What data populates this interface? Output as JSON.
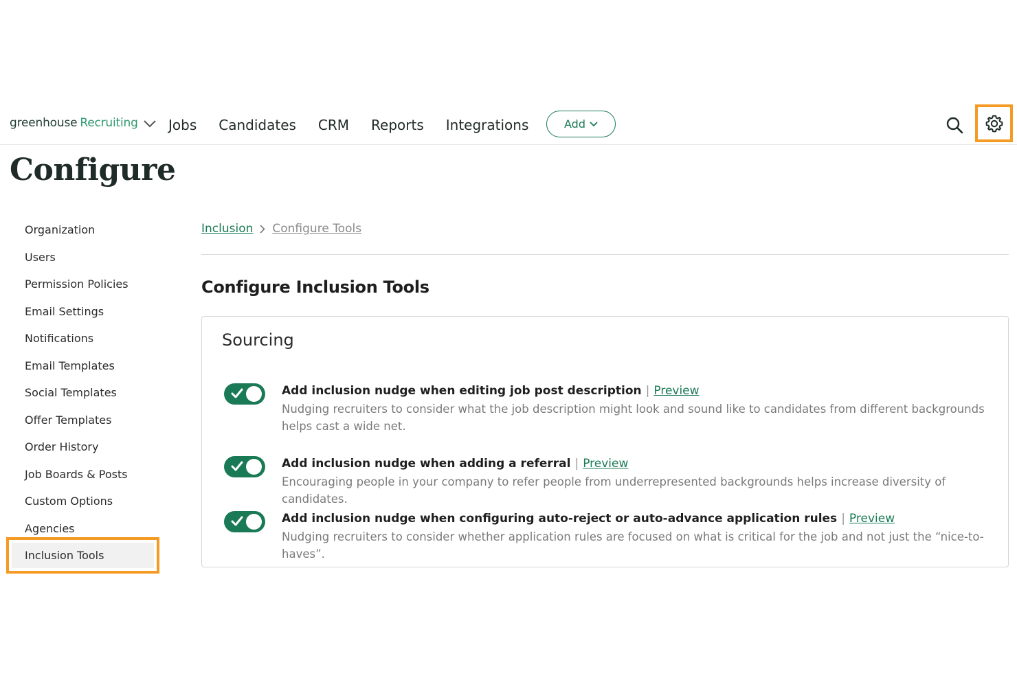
{
  "nav": {
    "logo_brand": "greenhouse",
    "logo_product": "Recruiting",
    "links": [
      "Jobs",
      "Candidates",
      "CRM",
      "Reports",
      "Integrations"
    ],
    "add_label": "Add",
    "search_icon": "search-icon",
    "settings_icon": "gear-icon"
  },
  "page": {
    "title": "Configure"
  },
  "sidebar": {
    "items": [
      "Organization",
      "Users",
      "Permission Policies",
      "Email Settings",
      "Notifications",
      "Email Templates",
      "Social Templates",
      "Offer Templates",
      "Order History",
      "Job Boards & Posts",
      "Custom Options",
      "Agencies",
      "Inclusion Tools"
    ],
    "active": "Inclusion Tools"
  },
  "breadcrumb": {
    "parent": "Inclusion",
    "current": "Configure Tools"
  },
  "main": {
    "heading": "Configure Inclusion Tools",
    "card_title": "Sourcing",
    "settings": [
      {
        "title": "Add inclusion nudge when editing job post description",
        "link": "Preview",
        "description": "Nudging recruiters to consider what the job description might look and sound like to candidates from different backgrounds helps cast a wide net.",
        "enabled": true
      },
      {
        "title": "Add inclusion nudge when adding a referral",
        "link": "Preview",
        "description": "Encouraging people in your company to refer people from underrepresented backgrounds helps increase diversity of candidates.",
        "enabled": true
      },
      {
        "title": "Add inclusion nudge when configuring auto-reject or auto-advance application rules",
        "link": "Preview",
        "description": "Nudging recruiters to consider whether application rules are focused on what is critical for the job and not just the “nice-to-haves”.",
        "enabled": true
      }
    ]
  },
  "colors": {
    "accent": "#1a7a55",
    "highlight": "#f59a23"
  }
}
